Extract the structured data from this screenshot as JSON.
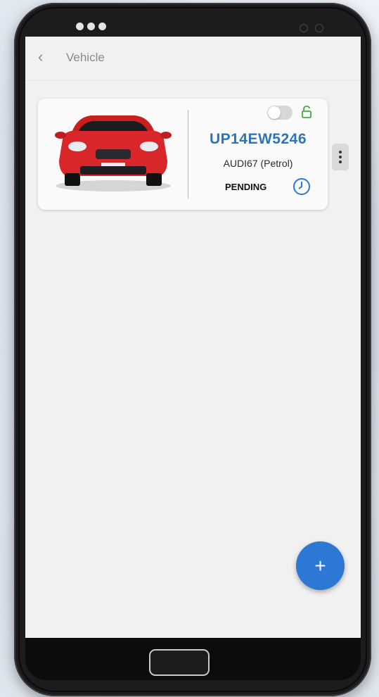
{
  "header": {
    "back_icon": "chevron-left-icon",
    "title": "Vehicle"
  },
  "vehicle_card": {
    "plate_number": "UP14EW5246",
    "model": "AUDI67 (Petrol)",
    "status": "PENDING",
    "toggle_on": false,
    "lock_icon": "unlocked-padlock-icon",
    "status_icon": "clock-icon",
    "menu_icon": "kebab-menu-icon"
  },
  "fab": {
    "label": "+"
  },
  "colors": {
    "accent_blue": "#2c78d4",
    "plate_blue": "#2e74b8",
    "lock_green": "#3fae3f",
    "car_red": "#d8262a"
  }
}
